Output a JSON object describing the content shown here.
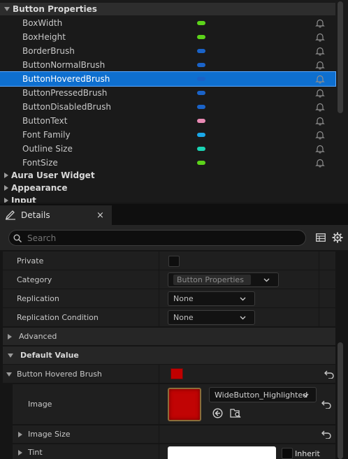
{
  "variables": {
    "section_title": "Button Properties",
    "items": [
      {
        "name": "BoxWidth",
        "type_color": "#5cd31a"
      },
      {
        "name": "BoxHeight",
        "type_color": "#5cd31a"
      },
      {
        "name": "BorderBrush",
        "type_color": "#1a63c8"
      },
      {
        "name": "ButtonNormalBrush",
        "type_color": "#1a63c8"
      },
      {
        "name": "ButtonHoveredBrush",
        "type_color": "#1a63c8"
      },
      {
        "name": "ButtonPressedBrush",
        "type_color": "#1a63c8"
      },
      {
        "name": "ButtonDisabledBrush",
        "type_color": "#1a63c8"
      },
      {
        "name": "ButtonText",
        "type_color": "#e88ab4"
      },
      {
        "name": "Font Family",
        "type_color": "#1aa8e8"
      },
      {
        "name": "Outline Size",
        "type_color": "#1ad4b4"
      },
      {
        "name": "FontSize",
        "type_color": "#5cd31a"
      }
    ],
    "selected_index": 4,
    "other_sections": [
      "Aura User Widget",
      "Appearance",
      "Input"
    ]
  },
  "details": {
    "tab_label": "Details",
    "close_glyph": "×",
    "search_placeholder": "Search",
    "rows": {
      "private_label": "Private",
      "category_label": "Category",
      "category_value": "Button Properties",
      "replication_label": "Replication",
      "replication_value": "None",
      "replication_condition_label": "Replication Condition",
      "replication_condition_value": "None"
    },
    "advanced_label": "Advanced",
    "default_value_label": "Default Value",
    "brush_label": "Button Hovered Brush",
    "brush_color": "#c00000",
    "image_label": "Image",
    "image_asset": "WideButton_Highlighted",
    "image_size_label": "Image Size",
    "tint_label": "Tint",
    "tint_color": "#ffffff",
    "inherit_label": "Inherit"
  }
}
